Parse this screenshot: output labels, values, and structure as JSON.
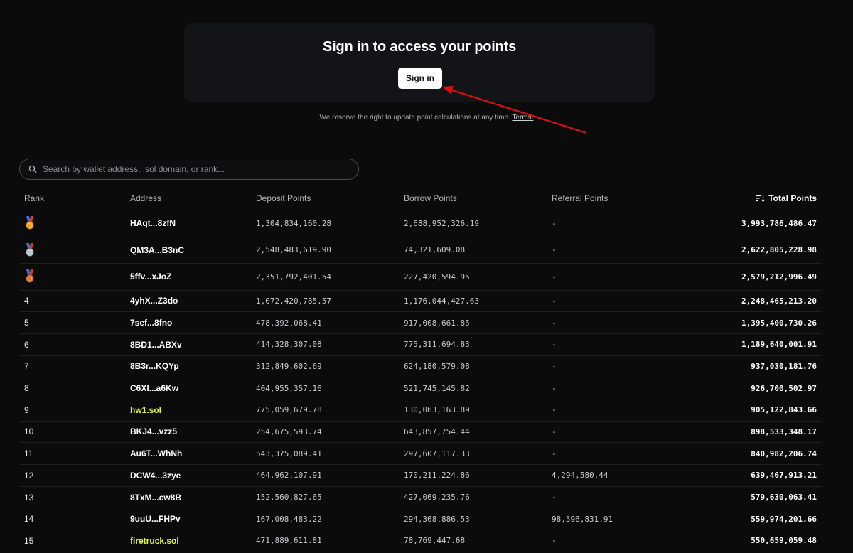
{
  "signin": {
    "title": "Sign in to access your points",
    "button_label": "Sign in"
  },
  "terms": {
    "text": "We reserve the right to update point calculations at any time.",
    "link_label": "Terms."
  },
  "search": {
    "placeholder": "Search by wallet address, .sol domain, or rank..."
  },
  "table": {
    "headers": {
      "rank": "Rank",
      "address": "Address",
      "deposit": "Deposit Points",
      "borrow": "Borrow Points",
      "referral": "Referral Points",
      "total": "Total Points"
    },
    "rows": [
      {
        "rank": "",
        "medal": "gold",
        "address": "HAqt...8zfN",
        "deposit": "1,304,834,160.28",
        "borrow": "2,688,952,326.19",
        "referral": "-",
        "total": "3,993,786,486.47"
      },
      {
        "rank": "",
        "medal": "silver",
        "address": "QM3A...B3nC",
        "deposit": "2,548,483,619.90",
        "borrow": "74,321,609.08",
        "referral": "-",
        "total": "2,622,805,228.98"
      },
      {
        "rank": "",
        "medal": "bronze",
        "address": "5ffv...xJoZ",
        "deposit": "2,351,792,401.54",
        "borrow": "227,420,594.95",
        "referral": "-",
        "total": "2,579,212,996.49"
      },
      {
        "rank": "4",
        "address": "4yhX...Z3do",
        "deposit": "1,072,420,785.57",
        "borrow": "1,176,044,427.63",
        "referral": "-",
        "total": "2,248,465,213.20"
      },
      {
        "rank": "5",
        "address": "7sef...8fno",
        "deposit": "478,392,068.41",
        "borrow": "917,008,661.85",
        "referral": "-",
        "total": "1,395,400,730.26"
      },
      {
        "rank": "6",
        "address": "8BD1...ABXv",
        "deposit": "414,328,307.08",
        "borrow": "775,311,694.83",
        "referral": "-",
        "total": "1,189,640,001.91"
      },
      {
        "rank": "7",
        "address": "8B3r...KQYp",
        "deposit": "312,849,602.69",
        "borrow": "624,180,579.08",
        "referral": "-",
        "total": "937,030,181.76"
      },
      {
        "rank": "8",
        "address": "C6Xl...a6Kw",
        "deposit": "404,955,357.16",
        "borrow": "521,745,145.82",
        "referral": "-",
        "total": "926,700,502.97"
      },
      {
        "rank": "9",
        "address": "hw1.sol",
        "sol": true,
        "deposit": "775,059,679.78",
        "borrow": "130,063,163.89",
        "referral": "-",
        "total": "905,122,843.66"
      },
      {
        "rank": "10",
        "address": "BKJ4...vzz5",
        "deposit": "254,675,593.74",
        "borrow": "643,857,754.44",
        "referral": "-",
        "total": "898,533,348.17"
      },
      {
        "rank": "11",
        "address": "Au6T...WhNh",
        "deposit": "543,375,089.41",
        "borrow": "297,607,117.33",
        "referral": "-",
        "total": "840,982,206.74"
      },
      {
        "rank": "12",
        "address": "DCW4...3zye",
        "deposit": "464,962,107.91",
        "borrow": "170,211,224.86",
        "referral": "4,294,580.44",
        "total": "639,467,913.21"
      },
      {
        "rank": "13",
        "address": "8TxM...cw8B",
        "deposit": "152,560,827.65",
        "borrow": "427,069,235.76",
        "referral": "-",
        "total": "579,630,063.41"
      },
      {
        "rank": "14",
        "address": "9uuU...FHPv",
        "deposit": "167,008,483.22",
        "borrow": "294,368,886.53",
        "referral": "98,596,831.91",
        "total": "559,974,201.66"
      },
      {
        "rank": "15",
        "address": "firetruck.sol",
        "sol": true,
        "deposit": "471,889,611.81",
        "borrow": "78,769,447.68",
        "referral": "-",
        "total": "550,659,059.48"
      }
    ]
  },
  "colors": {
    "background": "#0b0b0c",
    "card": "#131417",
    "sol_domain": "#e4f538",
    "annotation_arrow": "#e01010",
    "gold": "#f0a524",
    "silver": "#b9c3cc",
    "bronze": "#d9792b"
  },
  "icons": {
    "search": "search-icon",
    "sort": "sort-descending-icon",
    "medals": [
      "gold-medal-icon",
      "silver-medal-icon",
      "bronze-medal-icon"
    ]
  }
}
